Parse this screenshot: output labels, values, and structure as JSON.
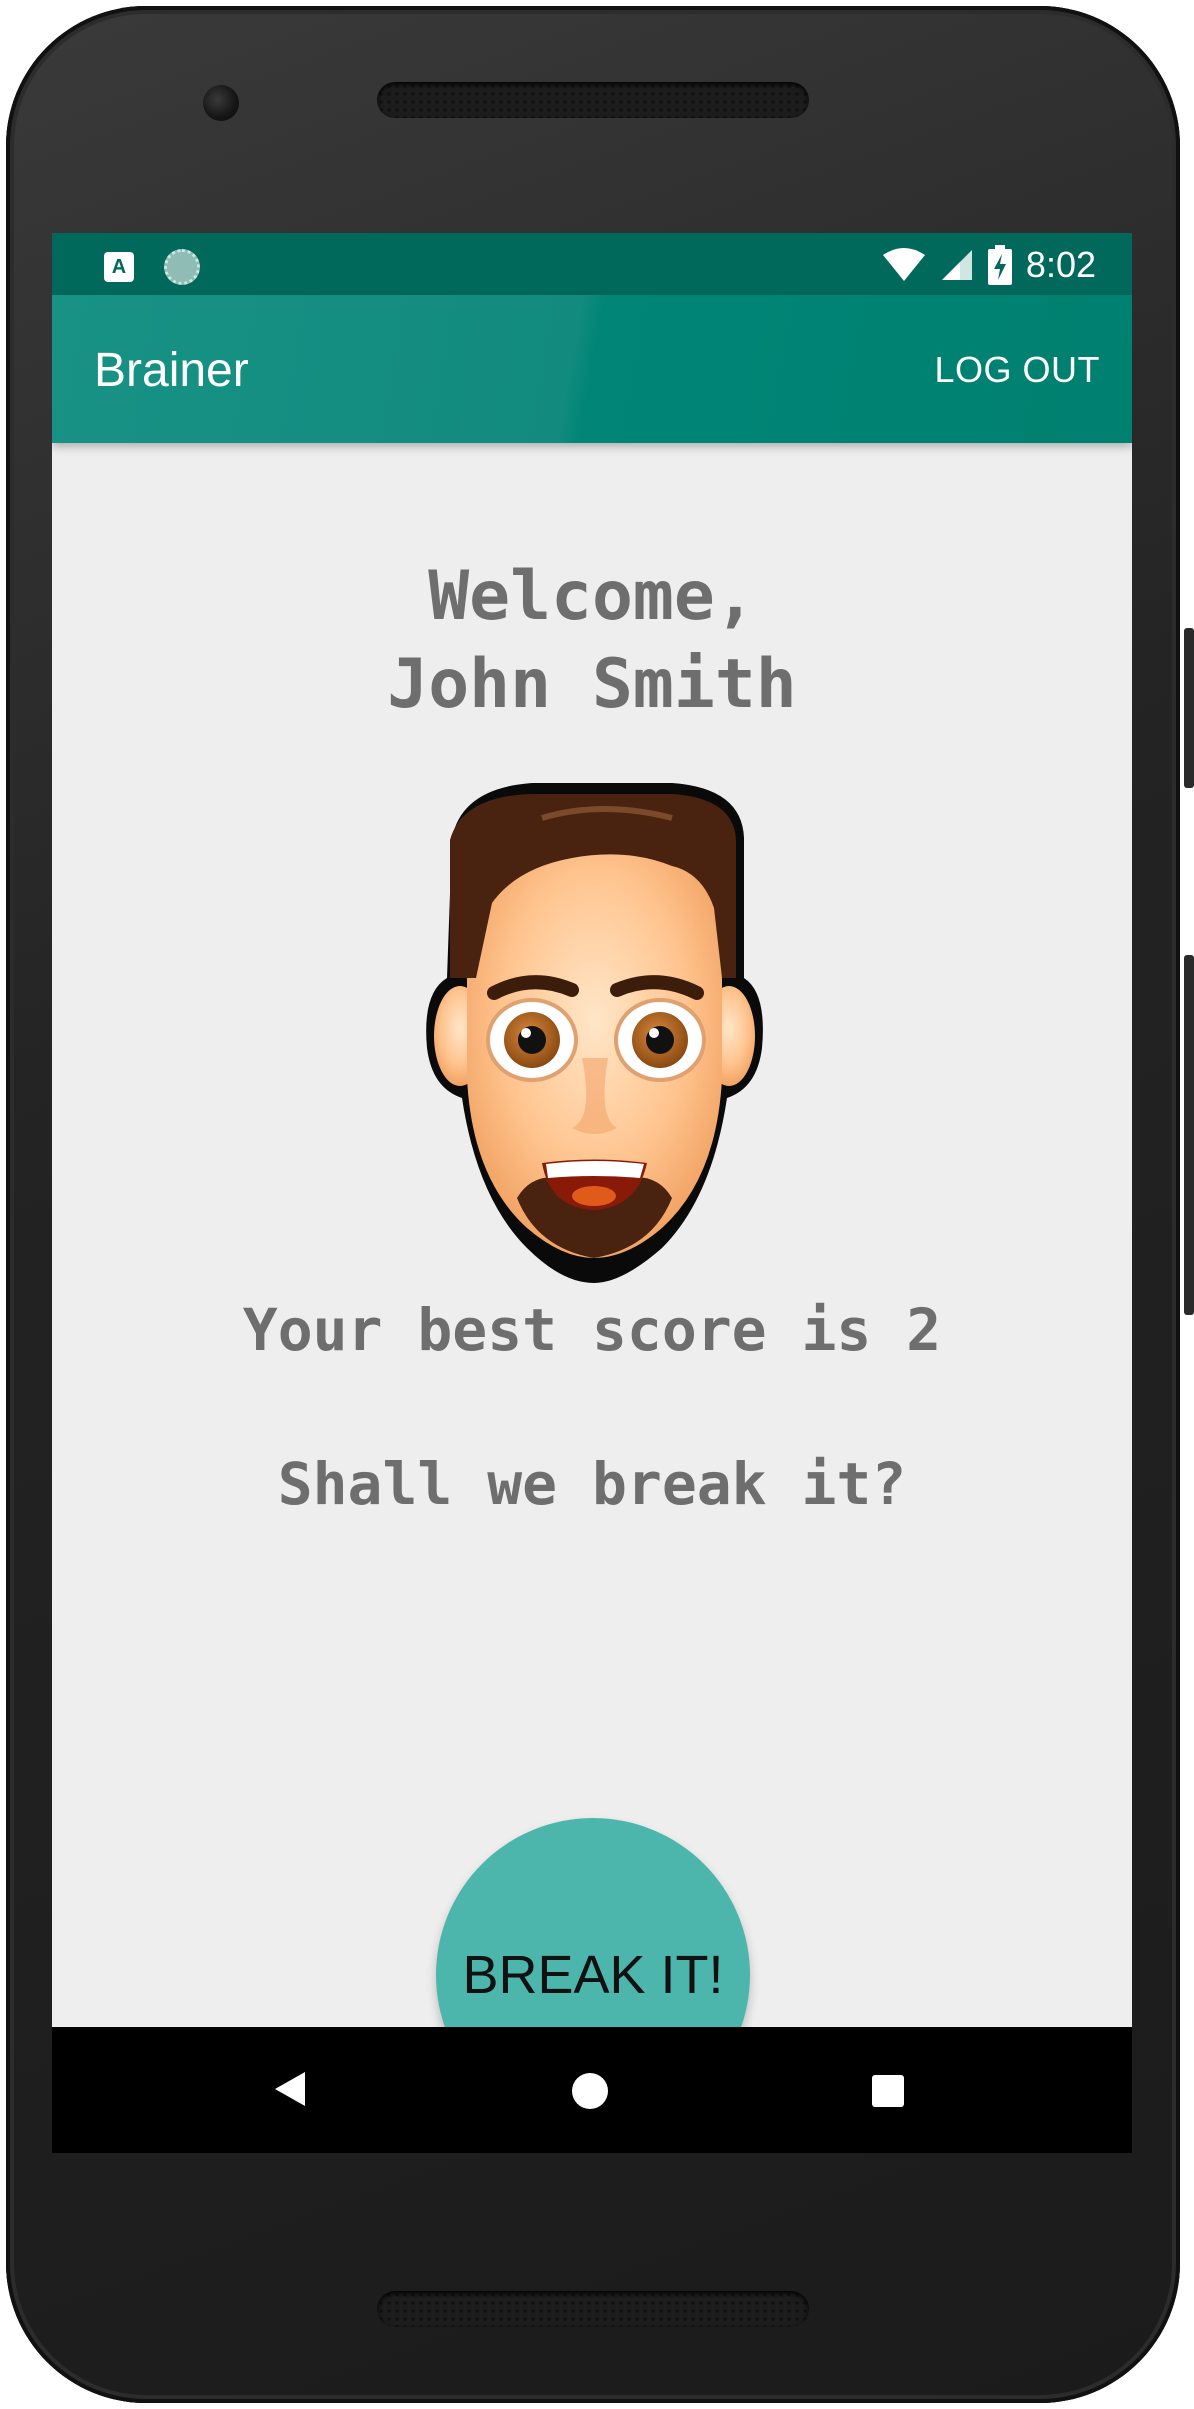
{
  "status_bar": {
    "app_indicator": "A",
    "time": "8:02",
    "icons": [
      "a-notification-icon",
      "sync-icon",
      "wifi-icon",
      "signal-icon",
      "battery-charging-icon"
    ]
  },
  "app_bar": {
    "title": "Brainer",
    "logout_label": "LOG OUT",
    "color": "#00897b"
  },
  "main": {
    "welcome_line1": "Welcome,",
    "welcome_line2": "John Smith",
    "avatar_icon": "man-face-avatar-icon",
    "score_text": "Your best score is 2",
    "challenge_text": "Shall we break it?",
    "break_button_label": "BREAK IT!",
    "accent_color": "#4db6ac"
  },
  "nav_bar": {
    "icons": [
      "back-icon",
      "home-icon",
      "recents-icon"
    ]
  }
}
